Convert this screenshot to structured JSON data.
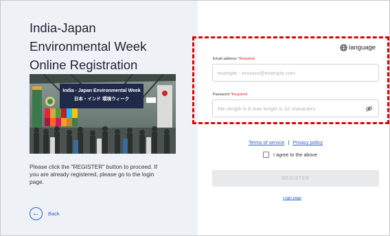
{
  "left": {
    "title_line1": "India-Japan",
    "title_line2": "Environmental Week",
    "title_line3": "Online Registration",
    "banner_line1": "India - Japan Environmental Week",
    "banner_line2": "日本・インド 環境ウィーク",
    "description": "Please click the \"REGISTER\" button to proceed. If you are already registered, please go to the login page.",
    "back_label": "Back"
  },
  "form": {
    "language_label": "language",
    "email_label": "Email address",
    "email_required": "*Required",
    "email_placeholder": "example : xxxxxxx@example.com",
    "password_label": "Password",
    "password_required": "*Required",
    "password_placeholder": "Min length is 8 max length is 32 characters",
    "terms_label": "Terms of service",
    "separator": "|",
    "privacy_label": "Privacy policy",
    "agree_label": "I agree to the above",
    "register_label": "REGISTER",
    "login_label": "Login page"
  },
  "colors": {
    "left_panel_bg": "#eef1f6",
    "link_blue": "#2f5bd0",
    "required_red": "#e02020",
    "highlight_dashed_red": "#e00000",
    "disabled_button_bg": "#e8e9eb"
  },
  "icons": {
    "back": "arrow-left-circle-icon",
    "language": "globe-icon",
    "password_toggle": "eye-slash-icon"
  }
}
